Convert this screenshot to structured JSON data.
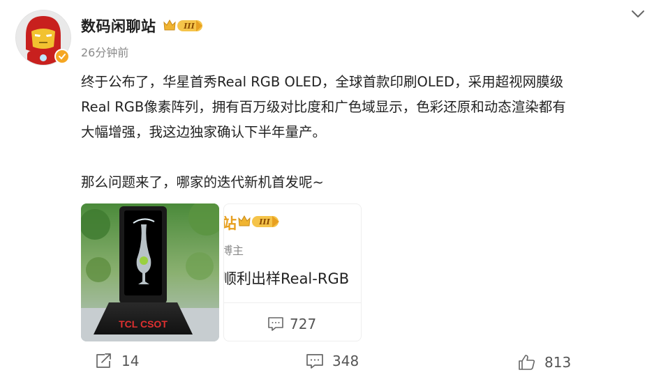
{
  "author": {
    "name": "数码闲聊站",
    "level_badge": "III",
    "timestamp": "26分钟前",
    "avatar_icon": "iron-man-avatar",
    "verified_icon": "verified-badge-icon"
  },
  "post": {
    "paragraphs": [
      "终于公布了，华星首秀Real RGB OLED，全球首款印刷OLED，采用超视网膜级",
      "Real RGB像素阵列，拥有百万级对比度和广色域显示，色彩还原和动态渲染都有",
      "大幅增强，我这边独家确认下半年量产。",
      "那么问题来了，哪家的迭代新机首发呢~"
    ]
  },
  "media": {
    "photo_brand_text": "TCL CSOT"
  },
  "repost_card": {
    "name": "站",
    "level_badge": "III",
    "role": "博主",
    "text": "顺利出样Real-RGB",
    "comment_count": "727"
  },
  "actions": {
    "share_count": "14",
    "comment_count": "348",
    "like_count": "813"
  },
  "colors": {
    "accent_gold": "#e8a020",
    "text_primary": "#222222",
    "text_secondary": "#8a8a8a"
  }
}
